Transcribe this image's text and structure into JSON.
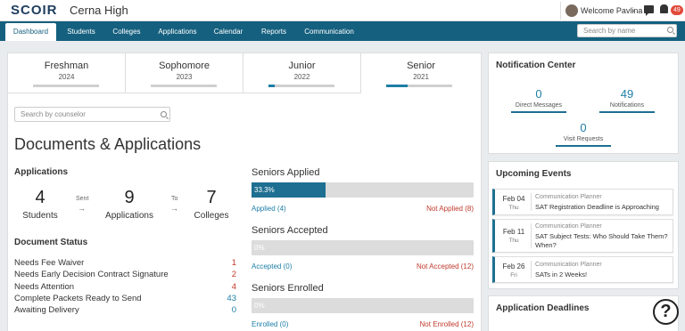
{
  "header": {
    "logo": "SCOIR",
    "school": "Cerna High",
    "welcome": "Welcome Pavlina",
    "notification_count": "49"
  },
  "nav": {
    "tabs": [
      "Dashboard",
      "Students",
      "Colleges",
      "Applications",
      "Calendar",
      "Reports",
      "Communication"
    ],
    "active_tab": "Dashboard",
    "search_placeholder": "Search by name"
  },
  "years": [
    {
      "name": "Freshman",
      "year": "2024",
      "progress": 0
    },
    {
      "name": "Sophomore",
      "year": "2023",
      "progress": 0
    },
    {
      "name": "Junior",
      "year": "2022",
      "progress": 0.1
    },
    {
      "name": "Senior",
      "year": "2021",
      "progress": 0.33
    }
  ],
  "active_year": "Senior",
  "counselor_placeholder": "Search by counselor",
  "section_title": "Documents & Applications",
  "applications": {
    "heading": "Applications",
    "students_count": "4",
    "students_label": "Students",
    "sent_label": "Sent",
    "applications_count": "9",
    "applications_label": "Applications",
    "to_label": "To",
    "colleges_count": "7",
    "colleges_label": "Colleges"
  },
  "document_status": {
    "heading": "Document Status",
    "rows": [
      {
        "label": "Needs Fee Waiver",
        "value": "1",
        "color": "red"
      },
      {
        "label": "Needs Early Decision Contract Signature",
        "value": "2",
        "color": "red"
      },
      {
        "label": "Needs Attention",
        "value": "4",
        "color": "red"
      },
      {
        "label": "Complete Packets Ready to Send",
        "value": "43",
        "color": "blue"
      },
      {
        "label": "Awaiting Delivery",
        "value": "0",
        "color": "blue"
      }
    ]
  },
  "seniors": [
    {
      "title": "Seniors Applied",
      "percent_label": "33.3%",
      "fraction": 0.333,
      "yes": "Applied (4)",
      "no": "Not Applied (8)"
    },
    {
      "title": "Seniors Accepted",
      "percent_label": "0%",
      "fraction": 0,
      "yes": "Accepted (0)",
      "no": "Not Accepted (12)"
    },
    {
      "title": "Seniors Enrolled",
      "percent_label": "0%",
      "fraction": 0,
      "yes": "Enrolled (0)",
      "no": "Not Enrolled (12)"
    }
  ],
  "notification_center": {
    "title": "Notification Center",
    "direct_messages": "0",
    "direct_messages_label": "Direct Messages",
    "notifications": "49",
    "notifications_label": "Notifications",
    "visit_requests": "0",
    "visit_requests_label": "Visit Requests"
  },
  "upcoming_events": {
    "title": "Upcoming Events",
    "events": [
      {
        "date": "Feb 04",
        "dow": "Thu",
        "type": "Communication Planner",
        "title": "SAT Registration Deadline is Approaching"
      },
      {
        "date": "Feb 11",
        "dow": "Thu",
        "type": "Communication Planner",
        "title": "SAT Subject Tests: Who Should Take Them? When?"
      },
      {
        "date": "Feb 26",
        "dow": "Fri",
        "type": "Communication Planner",
        "title": "SATs in 2 Weeks!"
      }
    ]
  },
  "application_deadlines": {
    "title": "Application Deadlines"
  },
  "help_symbol": "?",
  "colors": {
    "brand_navy": "#1d3d5e",
    "nav_teal": "#15607f",
    "accent_blue": "#1d7ea6",
    "alert_red": "#c0392b"
  }
}
